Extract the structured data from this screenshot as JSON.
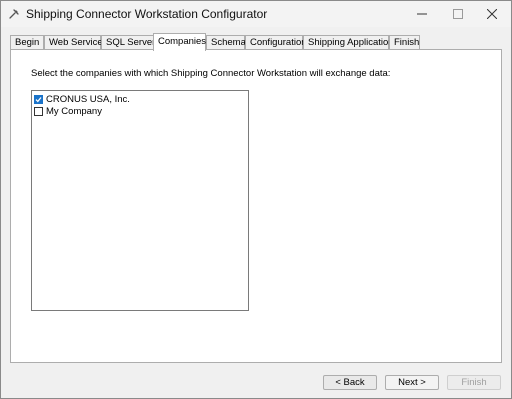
{
  "window": {
    "title": "Shipping Connector Workstation Configurator",
    "minimize_glyph": "–",
    "maximize_glyph": "☐",
    "close_glyph": "✕"
  },
  "tabs": [
    {
      "label": "Begin",
      "active": false
    },
    {
      "label": "Web Service",
      "active": false
    },
    {
      "label": "SQL Server",
      "active": false
    },
    {
      "label": "Companies",
      "active": true
    },
    {
      "label": "Schema",
      "active": false
    },
    {
      "label": "Configuration",
      "active": false
    },
    {
      "label": "Shipping Applications",
      "active": false
    },
    {
      "label": "Finish",
      "active": false
    }
  ],
  "companies_page": {
    "instruction": "Select the companies with which Shipping Connector Workstation will exchange data:",
    "companies": [
      {
        "name": "CRONUS USA, Inc.",
        "checked": true
      },
      {
        "name": "My Company",
        "checked": false
      }
    ]
  },
  "buttons": {
    "back": "< Back",
    "next": "Next >",
    "finish": "Finish"
  },
  "colors": {
    "checkbox_checked": "#1a73c9",
    "disabled_text": "#a0a0a0"
  }
}
